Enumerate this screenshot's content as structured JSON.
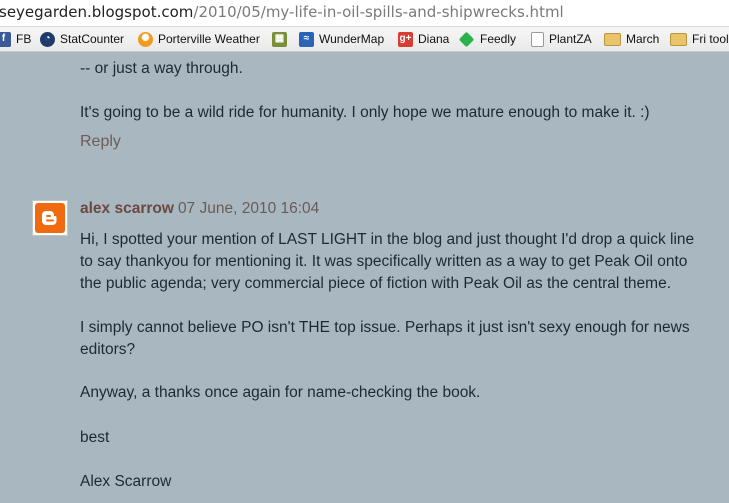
{
  "address_bar": {
    "host": "seyegarden.blogspot.com",
    "path": "/2010/05/my-life-in-oil-spills-and-shipwrecks.html"
  },
  "bookmarks": [
    {
      "label": "FB",
      "icon": "facebook-icon"
    },
    {
      "label": "StatCounter",
      "icon": "statcounter-icon"
    },
    {
      "label": "Porterville Weather",
      "icon": "weather-icon"
    },
    {
      "label": "",
      "icon": "image-icon"
    },
    {
      "label": "WunderMap",
      "icon": "wundermap-icon"
    },
    {
      "label": "Diana",
      "icon": "google-plus-icon"
    },
    {
      "label": "Feedly",
      "icon": "feedly-icon"
    },
    {
      "label": "PlantZA",
      "icon": "page-icon"
    },
    {
      "label": "March",
      "icon": "folder-icon"
    },
    {
      "label": "Fri tools",
      "icon": "folder-icon"
    }
  ],
  "previous_comment": {
    "line1": "-- or just a way through.",
    "line2": "It's going to be a wild ride for humanity. I only hope we mature enough to make it. :)",
    "reply": "Reply"
  },
  "comment": {
    "author": "alex scarrow",
    "date": "07 June, 2010 16:04",
    "paragraph1": [
      "Hi, I spotted your mention of LAST LIGHT in the blog and just thought I'd drop a quick line",
      "to say thankyou for mentioning it. It was specifically written as a way to get Peak Oil onto",
      "the public agenda; very commercial piece of fiction with Peak Oil as the central theme."
    ],
    "paragraph2": [
      "I simply cannot believe PO isn't THE top issue. Perhaps it just isn't sexy enough for news",
      "editors?"
    ],
    "paragraph3": "Anyway, a thanks once again for name-checking the book.",
    "paragraph4": "best",
    "signature": "Alex Scarrow"
  },
  "colors": {
    "page_background": "#a9b7c1",
    "body_text": "#1d2a34",
    "author_link": "#6a4a40",
    "avatar_orange": "#f06a0f"
  }
}
